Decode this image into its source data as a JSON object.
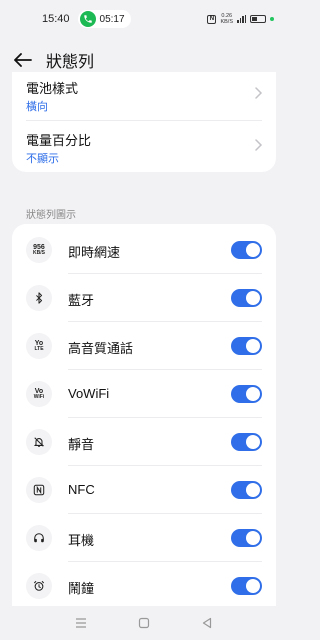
{
  "status_bar": {
    "time": "15:40",
    "call_time": "05:17",
    "nfc_label": "N",
    "net_speed": "0.26",
    "net_unit": "KB/S",
    "battery_level": 0.4,
    "charge_color": "#22c55e"
  },
  "header": {
    "back_icon": "arrow-left-icon",
    "title": "狀態列"
  },
  "battery_options": [
    {
      "label": "電池樣式",
      "value": "橫向"
    },
    {
      "label": "電量百分比",
      "value": "不顯示"
    }
  ],
  "section_title": "狀態列圖示",
  "icons": [
    {
      "label": "即時網速",
      "icon_text": "956\nKB/S",
      "icon": "net-speed-icon",
      "enabled": true
    },
    {
      "label": "藍牙",
      "icon_text": "",
      "icon": "bluetooth-icon",
      "enabled": true
    },
    {
      "label": "高音質通話",
      "icon_text": "Yo\nLTE",
      "icon": "volte-icon",
      "enabled": true
    },
    {
      "label": "VoWiFi",
      "icon_text": "Vo\nWiFi",
      "icon": "vowifi-icon",
      "enabled": true
    },
    {
      "label": "靜音",
      "icon_text": "",
      "icon": "mute-bell-icon",
      "enabled": true
    },
    {
      "label": "NFC",
      "icon_text": "",
      "icon": "nfc-icon",
      "enabled": true
    },
    {
      "label": "耳機",
      "icon_text": "",
      "icon": "headphones-icon",
      "enabled": true
    },
    {
      "label": "鬧鐘",
      "icon_text": "",
      "icon": "alarm-icon",
      "enabled": true
    }
  ],
  "colors": {
    "accent": "#2f6ee8",
    "background": "#f2f2f5",
    "card": "#ffffff"
  },
  "nav": {
    "menu_icon": "menu-icon",
    "home_icon": "home-square-icon",
    "back_icon": "back-triangle-icon"
  }
}
